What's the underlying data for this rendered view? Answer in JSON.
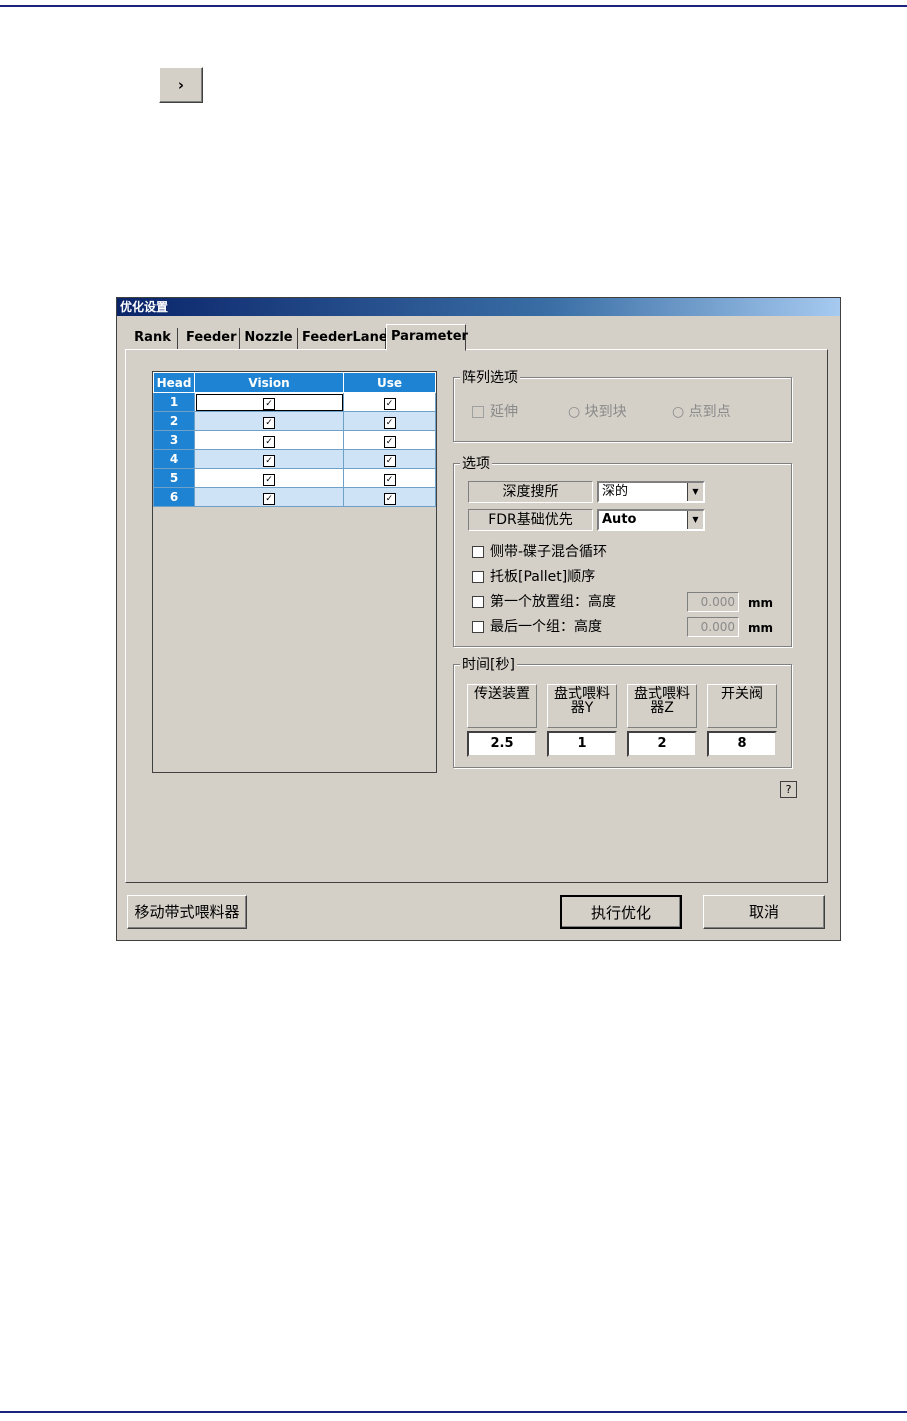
{
  "top_button": {
    "glyph": "›"
  },
  "dialog": {
    "title": "优化设置",
    "tabs": [
      "Rank",
      "Feeder",
      "Nozzle",
      "FeederLane",
      "Parameter"
    ],
    "active_tab": "Parameter",
    "head_table": {
      "columns": [
        "Head",
        "Vision",
        "Use"
      ],
      "rows": [
        {
          "head": "1",
          "vision": true,
          "use": true
        },
        {
          "head": "2",
          "vision": true,
          "use": true
        },
        {
          "head": "3",
          "vision": true,
          "use": true
        },
        {
          "head": "4",
          "vision": true,
          "use": true
        },
        {
          "head": "5",
          "vision": true,
          "use": true
        },
        {
          "head": "6",
          "vision": true,
          "use": true
        }
      ],
      "check_glyph": "✓"
    },
    "array_options": {
      "legend": "阵列选项",
      "extend_label": "延伸",
      "block_label": "块到块",
      "point_label": "点到点"
    },
    "options": {
      "legend": "选项",
      "depth_search_label": "深度搜所",
      "depth_search_value": "深的",
      "fdr_priority_label": "FDR基础优先",
      "fdr_priority_value": "Auto",
      "mix_cycle_label": "侧带-碟子混合循环",
      "pallet_order_label": "托板[Pallet]顺序",
      "first_group_label": "第一个放置组：高度",
      "first_group_value": "0.000",
      "last_group_label": "最后一个组：高度",
      "last_group_value": "0.000",
      "unit": "mm"
    },
    "time": {
      "legend": "时间[秒]",
      "headers": [
        "传送装置",
        "盘式喂料器Y",
        "盘式喂料器Z",
        "开关阀"
      ],
      "values": [
        "2.5",
        "1",
        "2",
        "8"
      ]
    },
    "help_label": "?",
    "buttons": {
      "move_feeder": "移动带式喂料器",
      "execute": "执行优化",
      "cancel": "取消"
    }
  }
}
